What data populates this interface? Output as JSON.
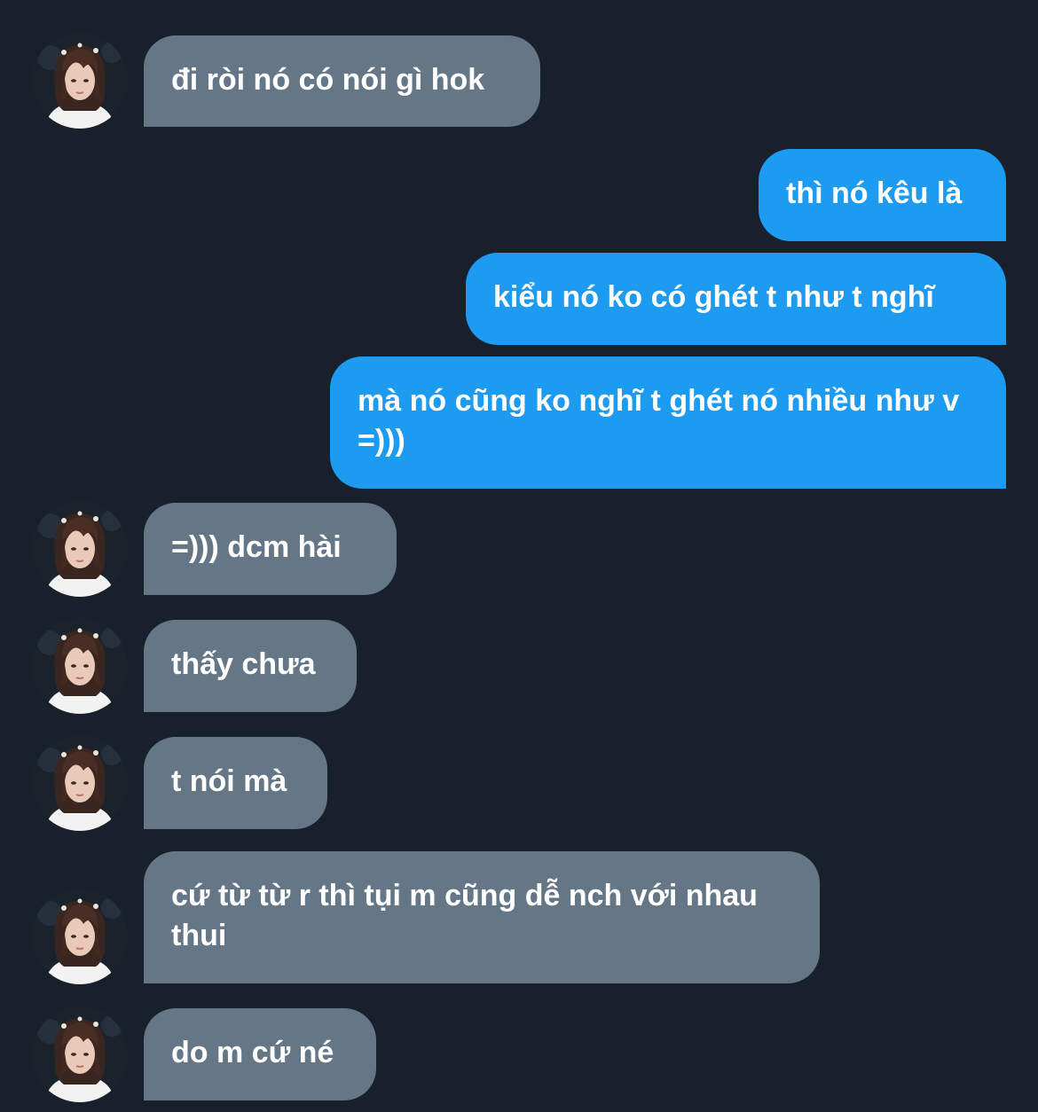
{
  "messages": [
    {
      "from": "other",
      "text": "đi ròi nó có nói gì hok"
    },
    {
      "from": "me",
      "text": "thì nó kêu là"
    },
    {
      "from": "me",
      "text": "kiểu nó ko có ghét t như t nghĩ"
    },
    {
      "from": "me",
      "text": "mà nó cũng ko nghĩ t ghét nó nhiều như v =)))"
    },
    {
      "from": "other",
      "text": "=))) dcm hài"
    },
    {
      "from": "other",
      "text": "thấy chưa"
    },
    {
      "from": "other",
      "text": "t nói mà"
    },
    {
      "from": "other",
      "text": "cứ từ từ r thì tụi m cũng dễ nch với nhau thui"
    },
    {
      "from": "other",
      "text": "do m cứ né"
    }
  ],
  "colors": {
    "background": "#17202b",
    "incoming_bubble": "#657786",
    "outgoing_bubble": "#1d9bf0",
    "text": "#ffffff"
  },
  "icons": {
    "avatar": "contact-avatar-icon"
  }
}
